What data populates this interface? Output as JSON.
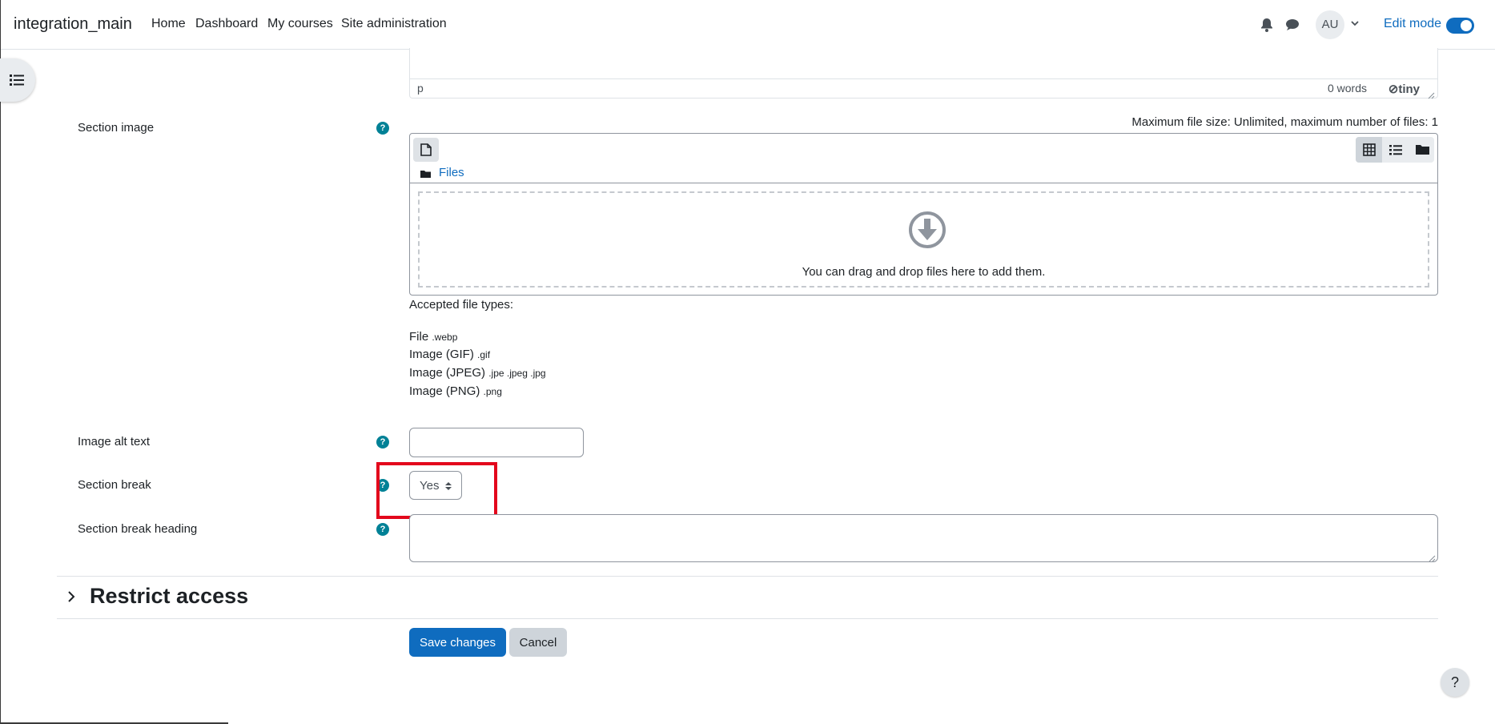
{
  "navbar": {
    "brand": "integration_main",
    "links": [
      "Home",
      "Dashboard",
      "My courses",
      "Site administration"
    ],
    "avatar_initials": "AU",
    "edit_mode_label": "Edit mode",
    "edit_mode_on": true
  },
  "editor": {
    "path": "p",
    "word_count": "0 words",
    "logo": "tiny"
  },
  "form": {
    "section_image_label": "Section image",
    "max_file_info": "Maximum file size: Unlimited, maximum number of files: 1",
    "filepicker_path": "Files",
    "dropzone_text": "You can drag and drop files here to add them.",
    "accepted_title": "Accepted file types:",
    "file_types": [
      {
        "name": "File",
        "ext": ".webp"
      },
      {
        "name": "Image (GIF)",
        "ext": ".gif"
      },
      {
        "name": "Image (JPEG)",
        "ext": ".jpe .jpeg .jpg"
      },
      {
        "name": "Image (PNG)",
        "ext": ".png"
      }
    ],
    "image_alt_label": "Image alt text",
    "image_alt_value": "",
    "section_break_label": "Section break",
    "section_break_value": "Yes",
    "section_break_heading_label": "Section break heading",
    "section_break_heading_value": "",
    "help_glyph": "?"
  },
  "restrict_access": {
    "title": "Restrict access"
  },
  "buttons": {
    "save": "Save changes",
    "cancel": "Cancel"
  },
  "floating_help": "?",
  "colors": {
    "primary": "#0f6cbf",
    "help": "#008196",
    "highlight": "#e3071c"
  }
}
